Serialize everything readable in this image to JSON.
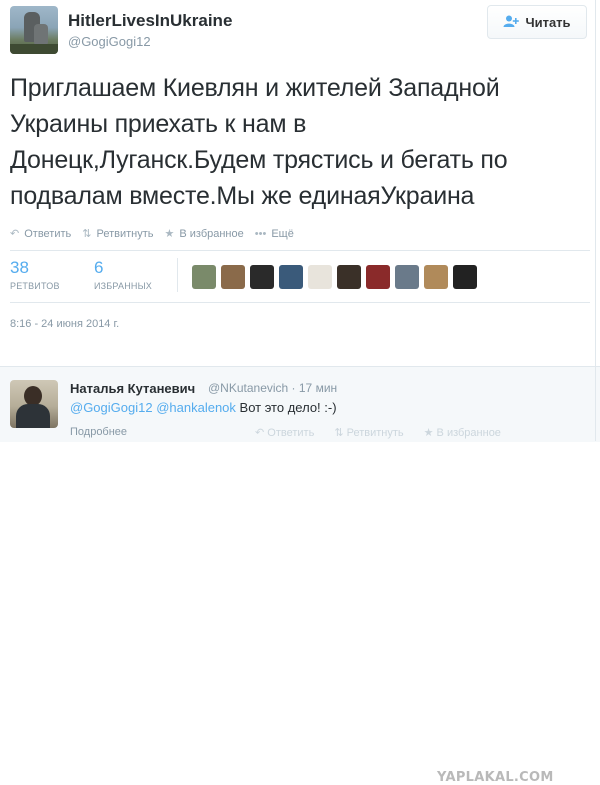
{
  "tweet": {
    "display_name": "HitlerLivesInUkraine",
    "screen_name": "@GogiGogi12",
    "follow_label": "Читать",
    "follow_icon": "add-user-icon",
    "text_lines": [
      "Приглашаем Киевлян и жителей Западной",
      "Украины приехать к нам в",
      "Донецк,Луганск.Будем трястись и бегать по",
      "подвалам вместе.Мы же единаяУкраина"
    ],
    "actions": {
      "reply": "Ответить",
      "retweet": "Ретвитнуть",
      "favorite": "В избранное",
      "more": "Ещё"
    },
    "stats": {
      "retweets_count": "38",
      "retweets_label": "РЕТВИТОВ",
      "favorites_count": "6",
      "favorites_label": "ИЗБРАННЫХ"
    },
    "fav_avatar_colors": [
      "#7a8a6a",
      "#8a6a4a",
      "#2a2a2a",
      "#3a5a7a",
      "#e8e4dc",
      "#3a3028",
      "#8a2a2a",
      "#6a7a8a",
      "#b08a5a",
      "#222222"
    ],
    "timestamp": "8:16 - 24 июня 2014 г."
  },
  "reply": {
    "name": "Наталья Кутаневич",
    "handle_time": "@NKutanevich · 17 мин",
    "mention1": "@GogiGogi12",
    "mention2": "@hankalenok",
    "text": "Вот это дело! :-)",
    "details": "Подробнее",
    "reply_label": "Ответить",
    "retweet_label": "Ретвитнуть",
    "favorite_label": "В избранное"
  },
  "watermark": "YAPLAKAL.COM"
}
